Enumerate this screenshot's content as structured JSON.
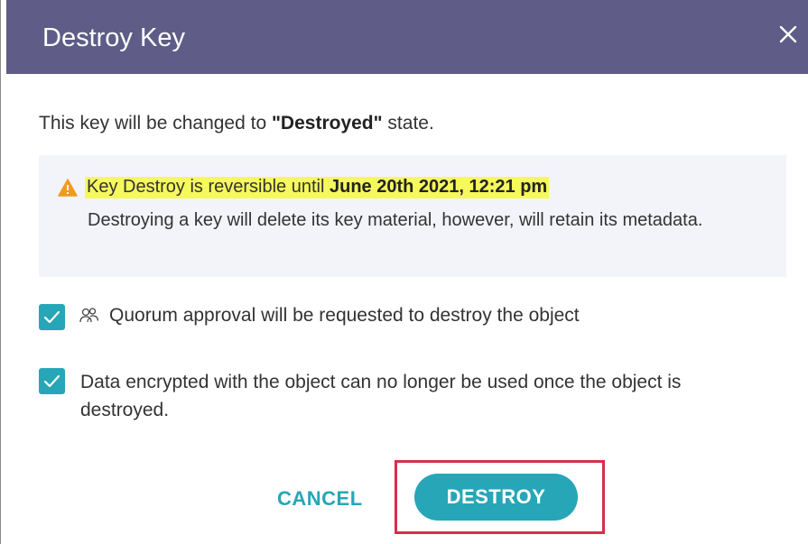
{
  "dialog": {
    "title": "Destroy Key",
    "close_icon": "close-icon"
  },
  "body": {
    "intro_prefix": "This key will be changed to ",
    "intro_state": "\"Destroyed\"",
    "intro_suffix": " state."
  },
  "warning": {
    "icon": "warning-icon",
    "line_prefix": "Key Destroy is reversible until ",
    "line_date": "June 20th 2021, 12:21 pm",
    "description": "Destroying a key will delete its key material, however, will retain its metadata.",
    "highlight_color": "#f6f95c"
  },
  "checkboxes": [
    {
      "checked": true,
      "icon": "quorum-group-icon",
      "label": "Quorum approval will be requested to destroy the object"
    },
    {
      "checked": true,
      "label": "Data encrypted with the object can no longer be used once the object is destroyed."
    }
  ],
  "actions": {
    "cancel_label": "CANCEL",
    "destroy_label": "DESTROY"
  },
  "colors": {
    "header": "#5f5d87",
    "accent": "#27a6b7",
    "highlight_frame": "#d62f4b"
  }
}
